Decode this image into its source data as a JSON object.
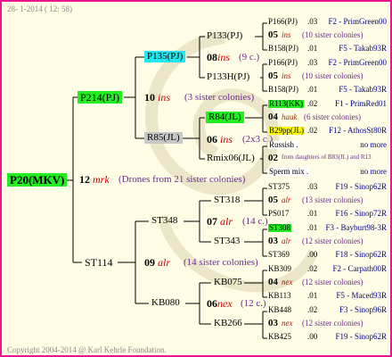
{
  "header": {
    "date": "28- 1-2014 ( 12: 58)"
  },
  "footer": {
    "copyright": "Copyright 2004-2014 @ Karl Kehrle Foundation."
  },
  "colors": {
    "border": "#e8188c",
    "background": "#fffde6",
    "green_box": "#22ee22",
    "cyan_box": "#22e6f0",
    "gray_box": "#c8c8c8",
    "yellow_box": "#ffff00"
  },
  "root": {
    "label": "P20(MKV)",
    "generation": "12",
    "race": "mrk",
    "note": "(Drones from 21 sister colonies)"
  },
  "mother": {
    "label": "P214(PJ)",
    "generation": "10",
    "race": "ins",
    "note": "(3 sister colonies)"
  },
  "father": {
    "label": "ST114",
    "generation": "09",
    "race": "alr",
    "note": "(14 sister colonies)"
  },
  "mm": {
    "label": "P135(PJ)",
    "generation": "08",
    "race": "ins",
    "note": "(9 c.)"
  },
  "mf": {
    "label": "R85(JL)",
    "generation": "06",
    "race": "ins",
    "note": "(2x3 c.)"
  },
  "fm": {
    "label": "ST348",
    "generation": "07",
    "race": "alr",
    "note": "(14 c.)"
  },
  "ff": {
    "label": "KB080",
    "generation": "06",
    "race": "nex",
    "note": "(12 c.)"
  },
  "g4": [
    {
      "label": "P133(PJ)"
    },
    {
      "label": "P133H(PJ)"
    },
    {
      "label": "R84(JL)"
    },
    {
      "label": "Rmix06(JL)"
    },
    {
      "label": "ST318"
    },
    {
      "label": "ST343"
    },
    {
      "label": "KB075"
    },
    {
      "label": "KB266"
    }
  ],
  "right": [
    {
      "name": "P166(PJ)",
      "gen": ".03",
      "info": "F2 - PrimGreen00"
    },
    {
      "gen": "05",
      "race": "ins",
      "note": "(10 sister colonies)"
    },
    {
      "name": "B158(PJ)",
      "gen": ".01",
      "info": "F5 - Takab93R"
    },
    {
      "name": "P166(PJ)",
      "gen": ".03",
      "info": "F2 - PrimGreen00"
    },
    {
      "gen": "05",
      "race": "ins",
      "note": "(10 sister colonies)"
    },
    {
      "name": "B158(PJ)",
      "gen": ".01",
      "info": "F5 - Takab93R"
    },
    {
      "name": "R113(KK)",
      "gen": ".02",
      "info": "F1 - PrimRed01"
    },
    {
      "gen": "04",
      "race": "hauk",
      "note": "(6 sister colonies)"
    },
    {
      "name": "B29pp(JL)",
      "gen": ".02",
      "info": "F12 - AthosSt80R"
    },
    {
      "name": "Russish .",
      "info": "no more"
    },
    {
      "gen": "02",
      "note": "from daughters of B83(JL) and R13"
    },
    {
      "name": "Sperm mix .",
      "info": "no more"
    },
    {
      "name": "ST375",
      "gen": ".03",
      "info": "F19 - Sinop62R"
    },
    {
      "gen": "05",
      "race": "alr",
      "note": "(13 sister colonies)"
    },
    {
      "name": "PS017",
      "gen": ".01",
      "info": "F16 - Sinop72R"
    },
    {
      "name": "ST308",
      "gen": ".01",
      "info": "F3 - Bayburt98-3R"
    },
    {
      "gen": "03",
      "race": "alr",
      "note": "(12 sister colonies)"
    },
    {
      "name": "ST369",
      "gen": ".00",
      "info": "F18 - Sinop62R"
    },
    {
      "name": "KB309",
      "gen": ".02",
      "info": "F2 - Carpath00R"
    },
    {
      "gen": "04",
      "race": "nex",
      "note": "(12 sister colonies)"
    },
    {
      "name": "KB113",
      "gen": ".01",
      "info": "F5 - Maced93R"
    },
    {
      "name": "KB448",
      "gen": ".02",
      "info": "F3 - Sinop96R"
    },
    {
      "gen": "03",
      "race": "nex",
      "note": "(12 sister colonies)"
    },
    {
      "name": "KB425",
      "gen": ".00",
      "info": "F19 - Sinop62R"
    }
  ]
}
